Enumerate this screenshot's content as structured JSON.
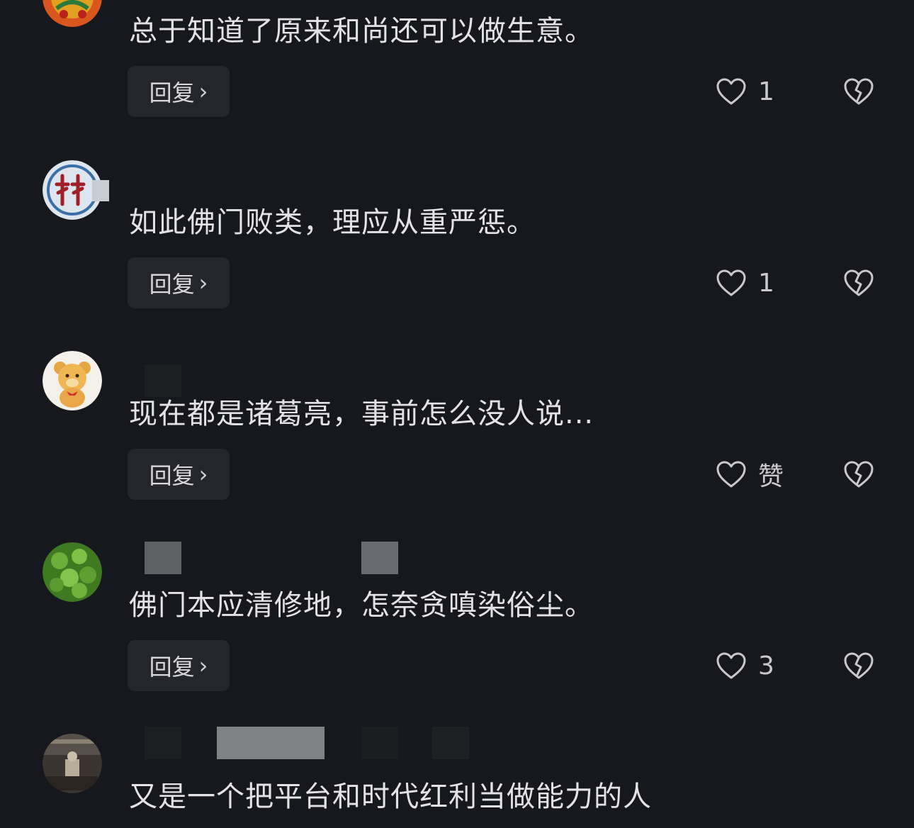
{
  "comments": [
    {
      "text": "总于知道了原来和尚还可以做生意。",
      "reply_label": "回复",
      "likes": "1"
    },
    {
      "text": "如此佛门败类，理应从重严惩。",
      "reply_label": "回复",
      "likes": "1"
    },
    {
      "text": "现在都是诸葛亮，事前怎么没人说...",
      "reply_label": "回复",
      "likes": "赞"
    },
    {
      "text": "佛门本应清修地，怎奈贪嗔染俗尘。",
      "reply_label": "回复",
      "likes": "3"
    },
    {
      "text": "又是一个把平台和时代红利当做能力的人"
    }
  ],
  "icons": {
    "reply_chevron": "chevron-right-icon",
    "like": "heart-outline-icon",
    "dislike": "broken-heart-icon"
  },
  "colors": {
    "background": "#16181d",
    "reply_button_bg": "#24262c",
    "text": "#e3e3e5",
    "icon": "#c9c9cc"
  }
}
